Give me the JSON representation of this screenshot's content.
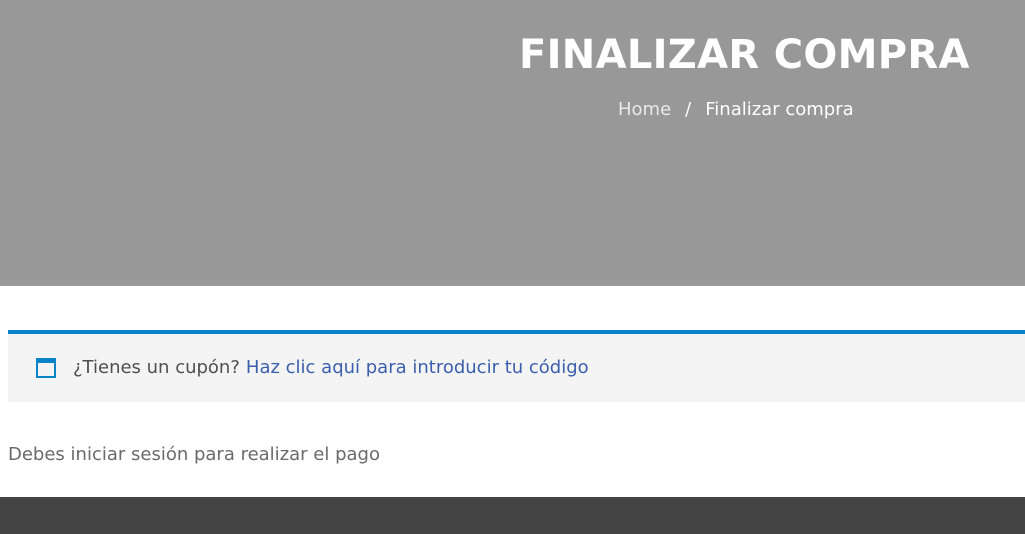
{
  "hero": {
    "title": "FINALIZAR COMPRA",
    "breadcrumb": {
      "home": "Home",
      "separator": "/",
      "current": "Finalizar compra"
    }
  },
  "coupon": {
    "icon": "window-icon",
    "prompt": "¿Tienes un cupón?",
    "link_text": "Haz clic aquí para introducir tu código",
    "accent_color": "#0a84c9"
  },
  "checkout": {
    "login_notice": "Debes iniciar sesión para realizar el pago"
  },
  "colors": {
    "hero_bg": "#989898",
    "footer_bg": "#444444",
    "link": "#3a5fad"
  }
}
